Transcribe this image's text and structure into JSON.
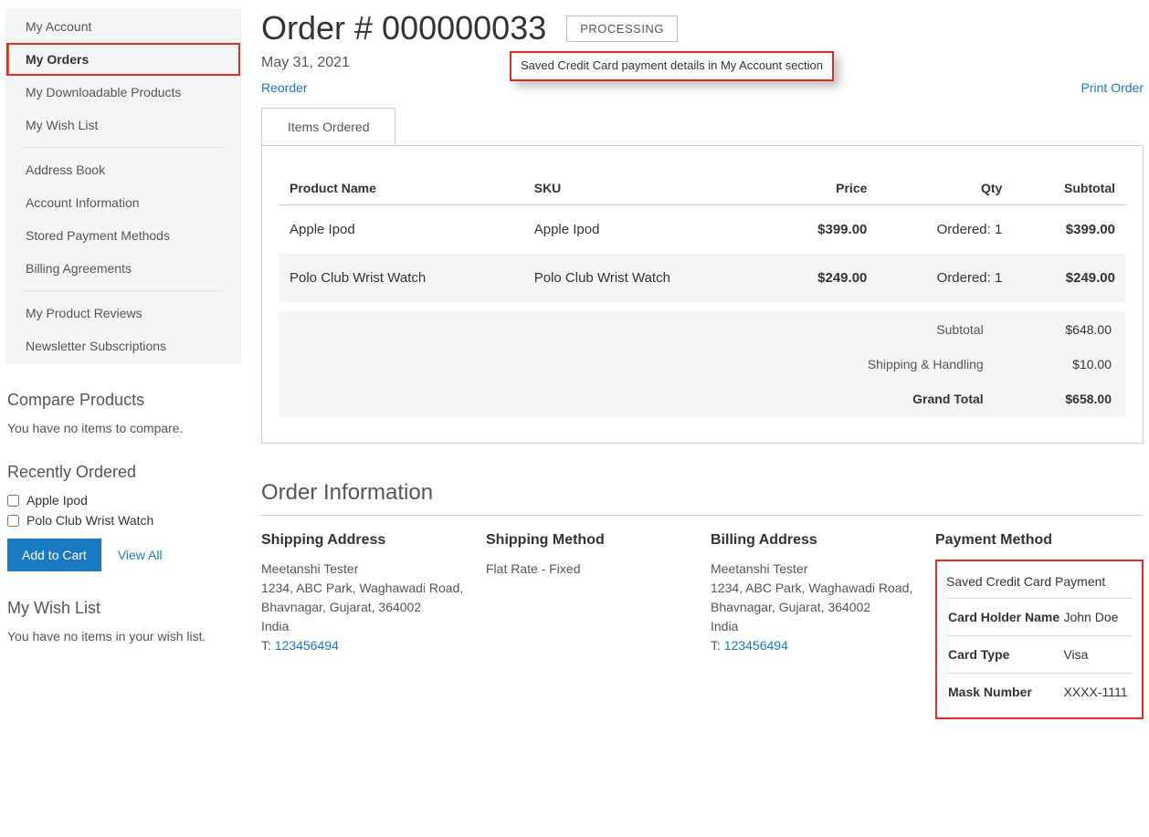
{
  "sidebar": {
    "nav": {
      "items": [
        "My Account",
        "My Orders",
        "My Downloadable Products",
        "My Wish List",
        "Address Book",
        "Account Information",
        "Stored Payment Methods",
        "Billing Agreements",
        "My Product Reviews",
        "Newsletter Subscriptions"
      ]
    },
    "compare": {
      "title": "Compare Products",
      "empty": "You have no items to compare."
    },
    "recent": {
      "title": "Recently Ordered",
      "items": [
        "Apple Ipod",
        "Polo Club Wrist Watch"
      ],
      "add": "Add to Cart",
      "viewall": "View All"
    },
    "wishlist": {
      "title": "My Wish List",
      "empty": "You have no items in your wish list."
    }
  },
  "callout": "Saved Credit Card payment details in My Account section",
  "order": {
    "title": "Order # 000000033",
    "status": "PROCESSING",
    "date": "May 31, 2021",
    "reorder": "Reorder",
    "print": "Print Order",
    "tab": "Items Ordered",
    "headers": {
      "name": "Product Name",
      "sku": "SKU",
      "price": "Price",
      "qty": "Qty",
      "subtotal": "Subtotal"
    },
    "items": [
      {
        "name": "Apple Ipod",
        "sku": "Apple Ipod",
        "price": "$399.00",
        "qty": "Ordered: 1",
        "subtotal": "$399.00"
      },
      {
        "name": "Polo Club Wrist Watch",
        "sku": "Polo Club Wrist Watch",
        "price": "$249.00",
        "qty": "Ordered: 1",
        "subtotal": "$249.00"
      }
    ],
    "totals": {
      "subtotal_label": "Subtotal",
      "subtotal": "$648.00",
      "shipping_label": "Shipping & Handling",
      "shipping": "$10.00",
      "grand_label": "Grand Total",
      "grand": "$658.00"
    }
  },
  "info": {
    "title": "Order Information",
    "shipping_addr": {
      "title": "Shipping Address",
      "name": "Meetanshi Tester",
      "l1": "1234, ABC Park, Waghawadi Road,",
      "l2": "Bhavnagar, Gujarat, 364002",
      "l3": "India",
      "t_label": "T:",
      "t_val": "123456494"
    },
    "shipping_method": {
      "title": "Shipping Method",
      "value": "Flat Rate - Fixed"
    },
    "billing_addr": {
      "title": "Billing Address",
      "name": "Meetanshi Tester",
      "l1": "1234, ABC Park, Waghawadi Road,",
      "l2": "Bhavnagar, Gujarat, 364002",
      "l3": "India",
      "t_label": "T:",
      "t_val": "123456494"
    },
    "payment": {
      "title": "Payment Method",
      "method": "Saved Credit Card Payment",
      "rows": [
        {
          "k": "Card Holder Name",
          "v": "John Doe"
        },
        {
          "k": "Card Type",
          "v": "Visa"
        },
        {
          "k": "Mask Number",
          "v": "XXXX-1111"
        }
      ]
    }
  }
}
